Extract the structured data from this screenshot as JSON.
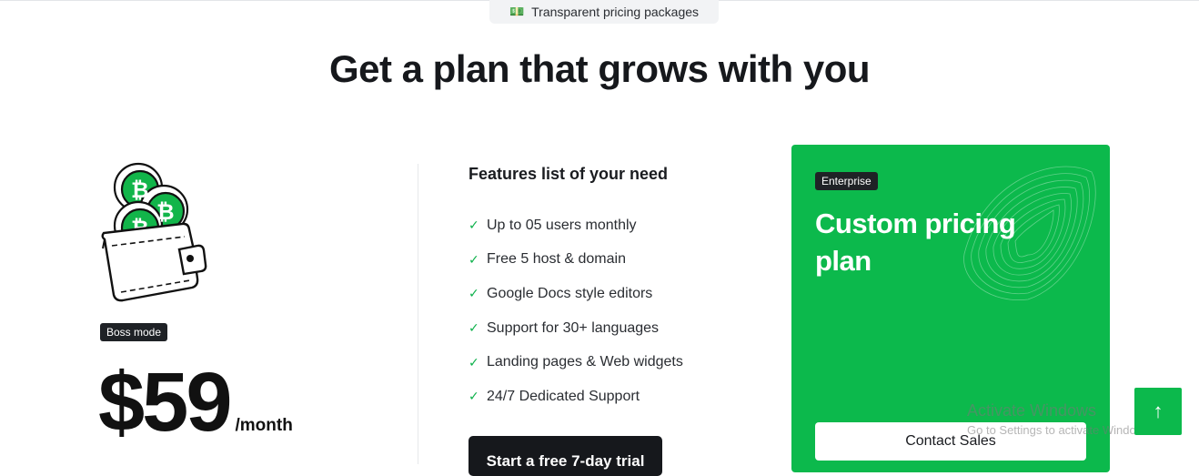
{
  "eyebrow": {
    "icon": "money-icon",
    "text": "Transparent pricing packages"
  },
  "headline": "Get a plan that grows with you",
  "boss_plan": {
    "badge": "Boss mode",
    "price": "$59",
    "period": "/month",
    "illustration": "wallet-bitcoin-icon"
  },
  "features": {
    "title": "Features list of your need",
    "items": [
      "Up to 05 users monthly",
      "Free 5 host & domain",
      "Google Docs style editors",
      "Support for 30+ languages",
      "Landing pages & Web widgets",
      "24/7 Dedicated Support"
    ],
    "check_icon": "check-icon",
    "cta": "Start a free 7-day trial"
  },
  "enterprise": {
    "badge": "Enterprise",
    "title": "Custom pricing plan",
    "cta": "Contact Sales",
    "background": "#0cb94c"
  },
  "scroll_top": {
    "icon": "arrow-up-icon",
    "glyph": "↑"
  },
  "watermark": {
    "line1": "Activate Windows",
    "line2": "Go to Settings to activate Windows."
  },
  "colors": {
    "accent": "#0cb94c",
    "dark": "#16181c",
    "badge_bg": "#1f2226"
  }
}
